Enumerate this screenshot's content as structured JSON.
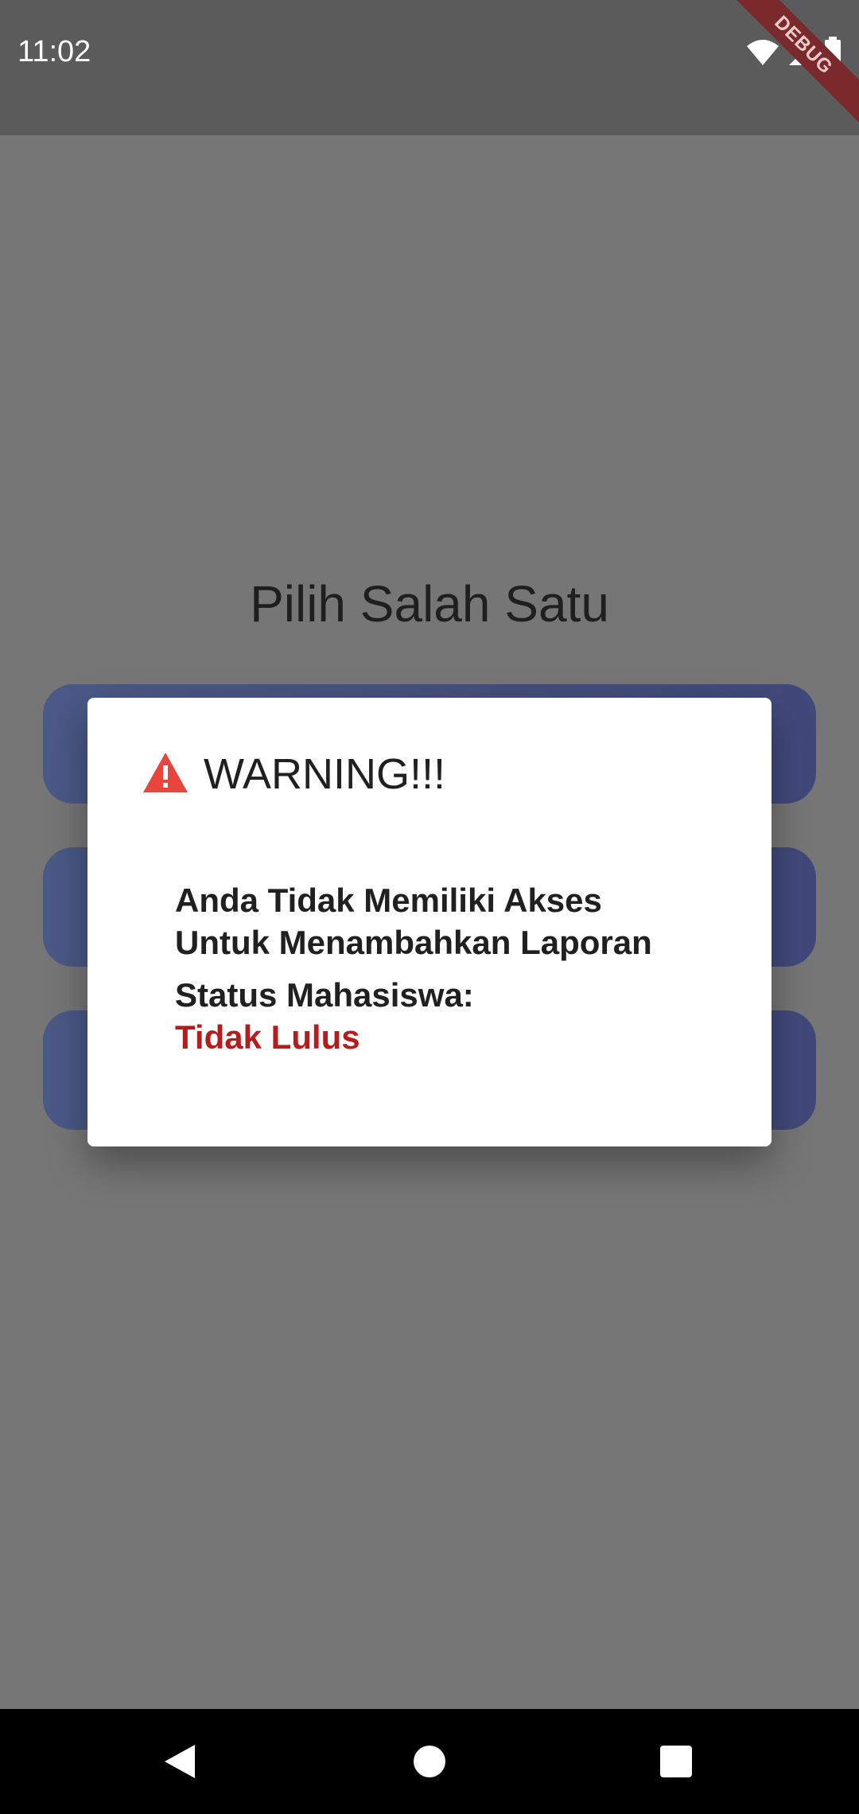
{
  "status_bar": {
    "time": "11:02",
    "icons": [
      "wifi-icon",
      "cell-signal-icon",
      "battery-icon"
    ],
    "debug_banner": "DEBUG"
  },
  "page": {
    "title": "Pilih Salah Satu",
    "menu_cards": 3
  },
  "dialog": {
    "icon": "warning-icon",
    "title": "WARNING!!!",
    "message_line1": "Anda Tidak Memiliki Akses",
    "message_line2": "Untuk Menambahkan Laporan",
    "status_label": "Status Mahasiswa:",
    "status_value": "Tidak Lulus",
    "status_color": "#b71c1c",
    "warning_color": "#e8453c"
  },
  "nav_bar": {
    "buttons": [
      "back-icon",
      "home-icon",
      "recents-icon"
    ]
  },
  "colors": {
    "scrim": "#767676",
    "status_bar": "#5b5b5b",
    "card": "#454e7c"
  }
}
